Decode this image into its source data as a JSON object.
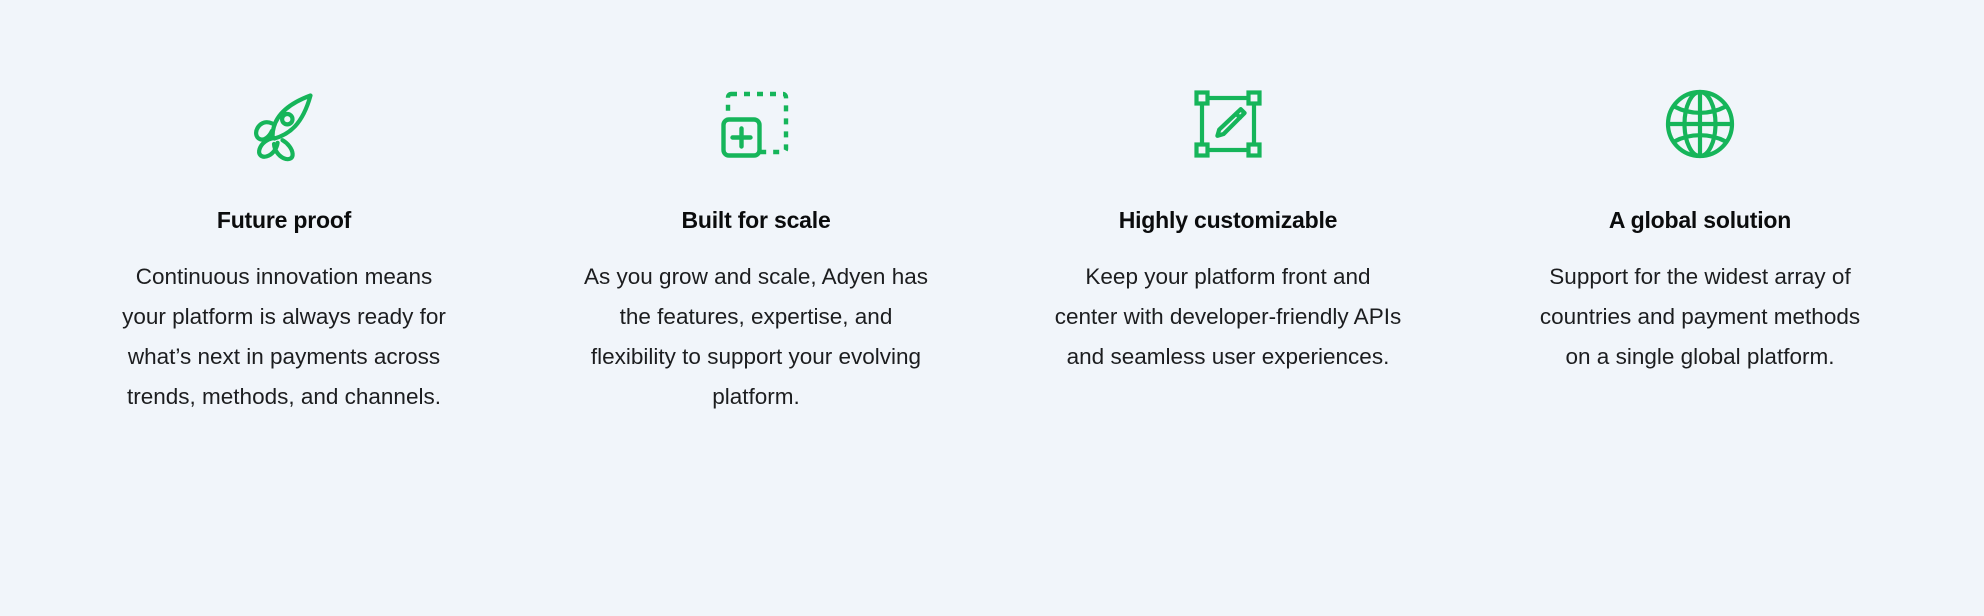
{
  "page": {
    "background_color": "#F1F5FA",
    "accent_color": "#16B55A",
    "title_color": "#0B0C0D",
    "body_color": "#1C1D1F"
  },
  "features": [
    {
      "icon": "rocket-icon",
      "title": "Future proof",
      "body": "Continuous innovation means your platform is always ready for what’s next in payments across trends, methods, and channels."
    },
    {
      "icon": "dashed-square-plus-icon",
      "title": "Built for scale",
      "body": "As you grow and scale, Adyen has the features, expertise, and flexibility to support your evolving platform."
    },
    {
      "icon": "selection-box-pencil-icon",
      "title": "Highly customizable",
      "body": "Keep your platform front and center with developer-friendly APIs and seamless user experiences."
    },
    {
      "icon": "globe-icon",
      "title": "A global solution",
      "body": "Support for the widest array of countries and payment methods on a single global platform."
    }
  ]
}
